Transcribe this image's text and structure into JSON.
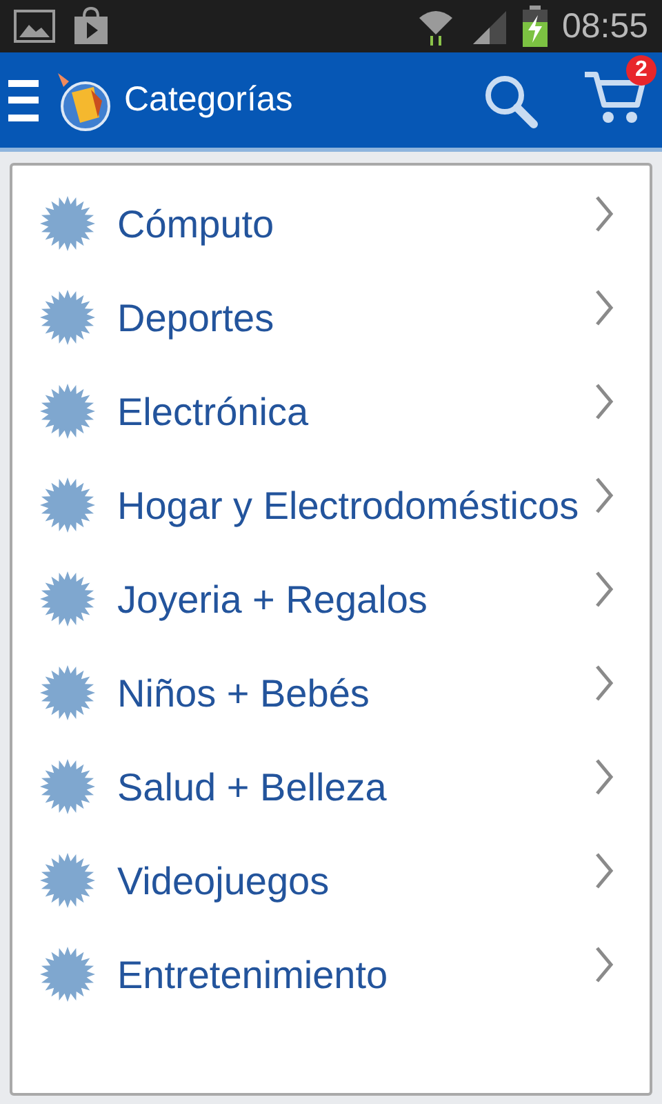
{
  "status_bar": {
    "time": "08:55"
  },
  "app_bar": {
    "title": "Categorías",
    "cart_count": "2"
  },
  "categories": [
    {
      "label": "Cómputo"
    },
    {
      "label": "Deportes"
    },
    {
      "label": "Electrónica"
    },
    {
      "label": "Hogar y Electrodomésticos"
    },
    {
      "label": "Joyeria + Regalos"
    },
    {
      "label": "Niños + Bebés"
    },
    {
      "label": "Salud + Belleza"
    },
    {
      "label": "Videojuegos"
    },
    {
      "label": "Entretenimiento"
    }
  ]
}
